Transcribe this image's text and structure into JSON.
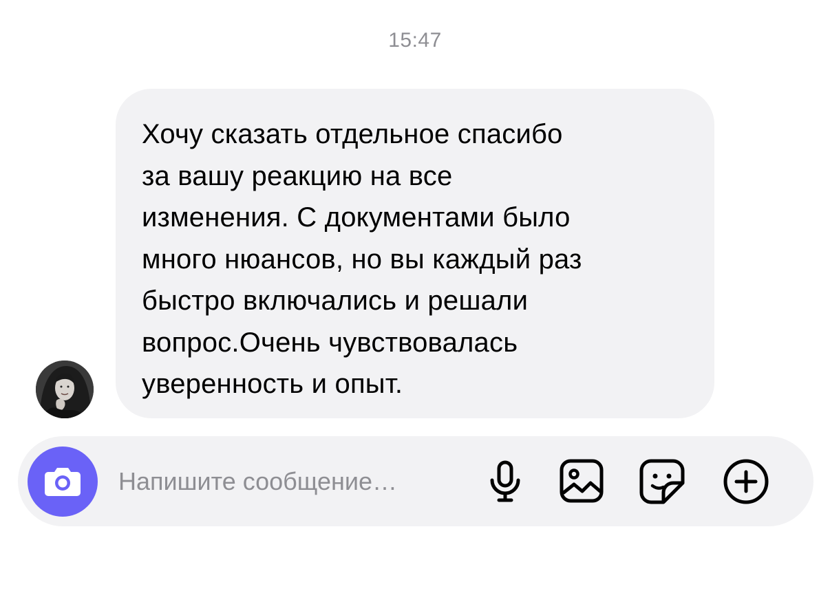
{
  "chat": {
    "timestamp": "15:47",
    "message": {
      "text": "Хочу сказать отдельное спасибо\nза вашу реакцию на все\nизменения. С документами было\nмного нюансов, но вы каждый раз\nбыстро включались и решали\nвопрос.Очень чувствовалась\nуверенность и опыт.",
      "bubble_color": "#f2f2f4"
    }
  },
  "composer": {
    "placeholder": "Напишите сообщение…",
    "value": "",
    "accent_color": "#6a62f7",
    "icons": [
      "camera-icon",
      "microphone-icon",
      "image-icon",
      "sticker-icon",
      "plus-circle-icon"
    ]
  }
}
